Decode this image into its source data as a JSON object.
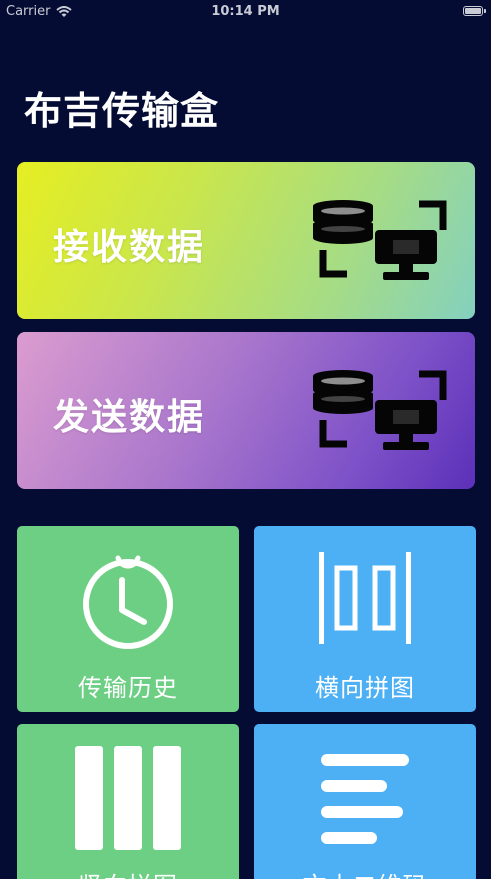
{
  "status_bar": {
    "carrier": "Carrier",
    "time": "10:14 PM",
    "wifi_icon": "wifi-icon",
    "battery_icon": "battery-icon"
  },
  "app": {
    "title": "布吉传输盒"
  },
  "cards": {
    "receive": {
      "label": "接收数据",
      "icon": "data-transfer-icon",
      "colors": [
        "#e6ee22",
        "#84d0bf"
      ]
    },
    "send": {
      "label": "发送数据",
      "icon": "data-transfer-icon",
      "colors": [
        "#db9ccf",
        "#5c30b8"
      ]
    }
  },
  "tiles": [
    {
      "label": "传输历史",
      "icon": "clock-icon",
      "color": "#6dcf83"
    },
    {
      "label": "横向拼图",
      "icon": "horizontal-stitch-icon",
      "color": "#4eb0f4"
    },
    {
      "label": "竖向拼图",
      "icon": "vertical-stitch-icon",
      "color": "#6dcf83"
    },
    {
      "label": "文本二维码",
      "icon": "text-lines-icon",
      "color": "#4eb0f4"
    }
  ]
}
